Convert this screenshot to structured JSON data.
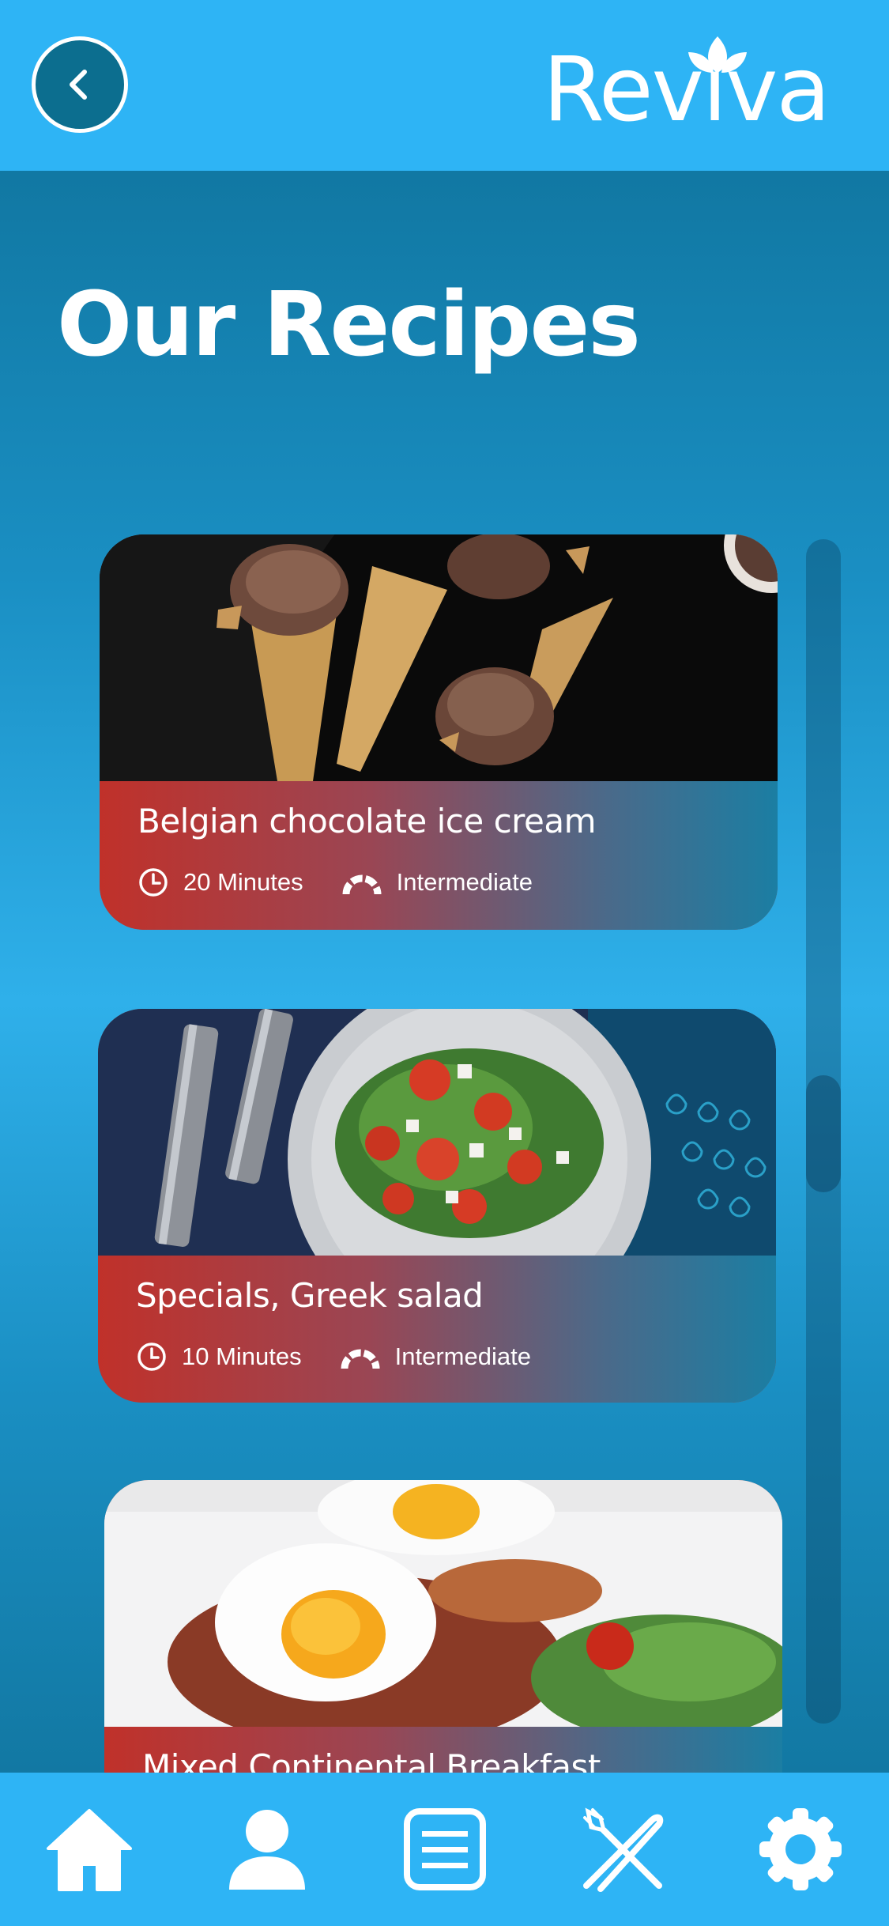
{
  "header": {
    "back_icon": "chevron-left-icon",
    "logo_text": "Reviva",
    "logo_icon": "leaf-icon"
  },
  "page": {
    "title": "Our Recipes"
  },
  "recipes": [
    {
      "name": "Belgian chocolate ice cream",
      "time": "20 Minutes",
      "difficulty": "Intermediate",
      "time_icon": "clock-icon",
      "difficulty_icon": "gauge-icon"
    },
    {
      "name": "Specials, Greek salad",
      "time": "10 Minutes",
      "difficulty": "Intermediate",
      "time_icon": "clock-icon",
      "difficulty_icon": "gauge-icon"
    },
    {
      "name": "Mixed Continental Breakfast"
    }
  ],
  "tabbar": [
    {
      "name": "home",
      "icon": "home-icon"
    },
    {
      "name": "profile",
      "icon": "user-icon"
    },
    {
      "name": "notes",
      "icon": "list-icon"
    },
    {
      "name": "recipes",
      "icon": "fork-knife-icon"
    },
    {
      "name": "settings",
      "icon": "gear-icon"
    }
  ],
  "colors": {
    "header_bg": "#2eb4f5",
    "card_accent": "#c0312a",
    "page_bg_dark": "#0d6e95"
  }
}
